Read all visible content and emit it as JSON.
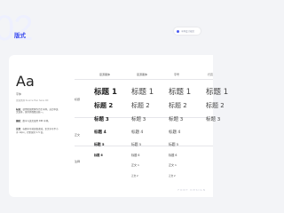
{
  "header": {
    "section_number": "02",
    "section_title": "版式",
    "pill_text": "字体设计规范"
  },
  "sample": {
    "glyph": "Aa",
    "caption": "字体",
    "sub": "思源黑体 Source Han Sans CN"
  },
  "notes": [
    {
      "label": "标准：",
      "text": "使用思源黑体作为主字体，适合中英文混排，保持界面整洁统一。"
    },
    {
      "label": "辅助：",
      "text": "数字与英文使用 DIN 字体。"
    },
    {
      "label": "注意：",
      "text": "标题字号按层级递减，正文字号不小于 12px，行距保持 1.5 倍。"
    }
  ],
  "columns": [
    "思源黑体",
    "思源黑体",
    "字号",
    "行高"
  ],
  "rows": [
    "标题",
    "正文",
    "注释"
  ],
  "headings_bold": [
    "标题 1",
    "标题 2",
    "标题 3",
    "标题 4",
    "标题 5",
    "标题 6"
  ],
  "headings_regular": [
    "标题 1",
    "标题 2",
    "标题 3",
    "标题 4",
    "标题 5",
    "标题 6"
  ],
  "headings_size": [
    "标题 1",
    "标题 2",
    "标题 3",
    "标题 4",
    "标题 5",
    "标题 6"
  ],
  "headings_last": [
    "标题 1",
    "标题 2",
    "标题 3"
  ],
  "body_rows": [
    "正文 1",
    "正文 2"
  ],
  "footer_text": "FONT DESIGN"
}
